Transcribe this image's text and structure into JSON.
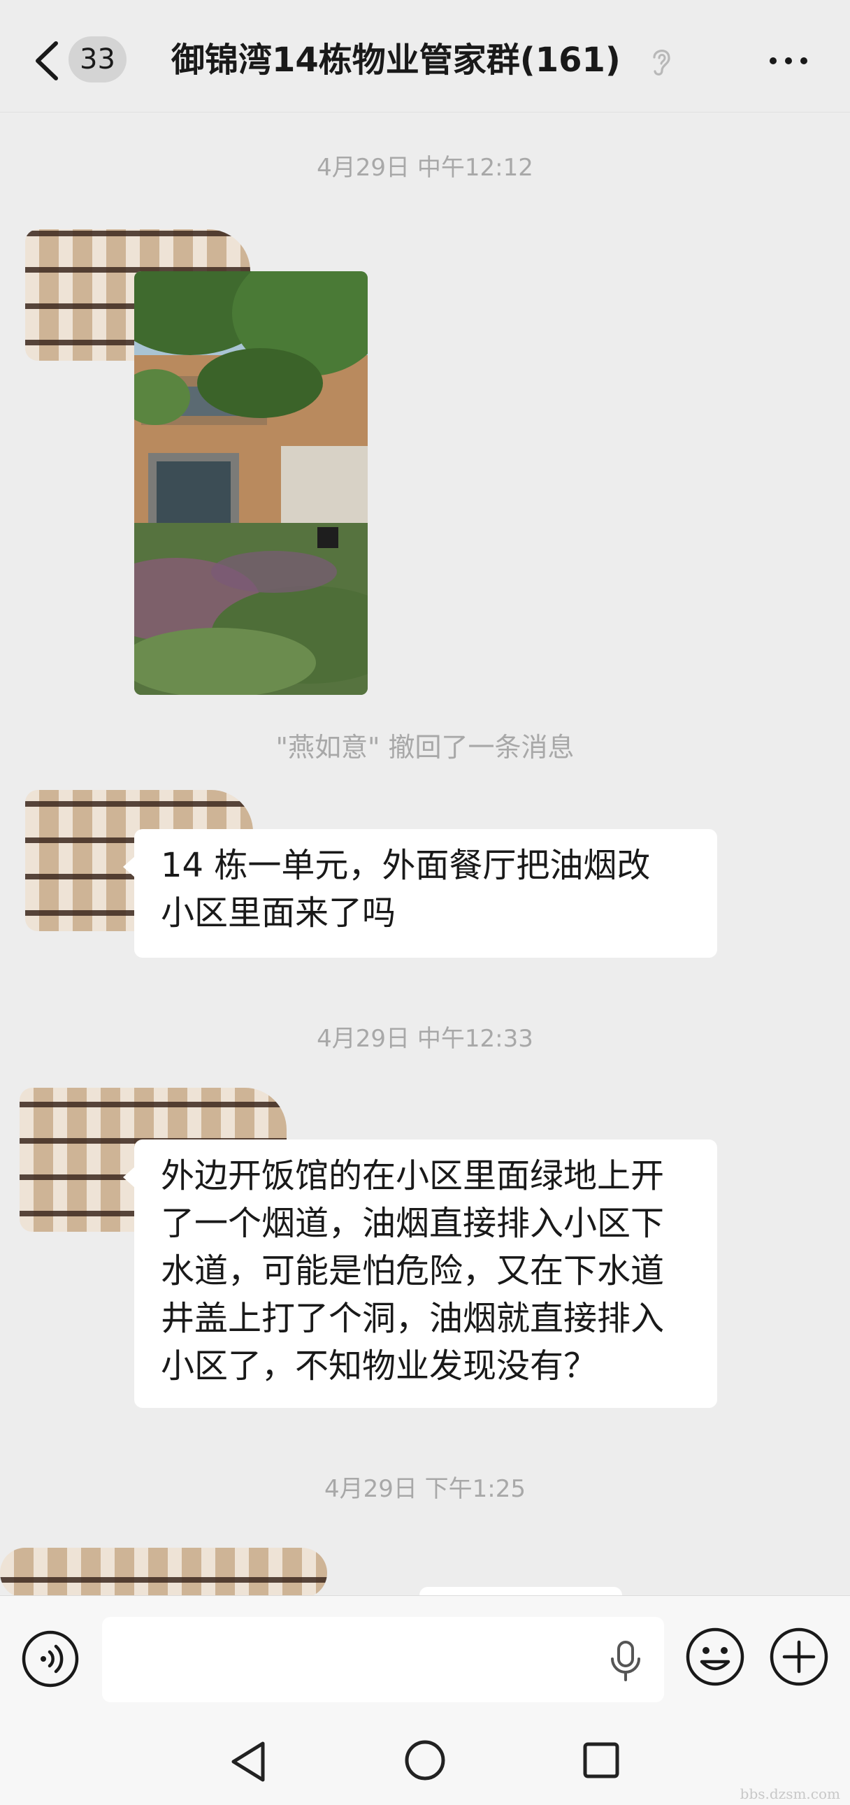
{
  "header": {
    "back_count": "33",
    "title": "御锦湾14栋物业管家群(161)"
  },
  "messages": [
    {
      "type": "timestamp",
      "text": "4月29日 中午12:12"
    },
    {
      "type": "image",
      "sender": "redacted"
    },
    {
      "type": "system",
      "text": "\"燕如意\" 撤回了一条消息"
    },
    {
      "type": "text",
      "sender": "redacted",
      "text": "14 栋一单元，外面餐厅把油烟改\n小区里面来了吗"
    },
    {
      "type": "timestamp",
      "text": "4月29日 中午12:33"
    },
    {
      "type": "text",
      "sender": "redacted",
      "text": "外边开饭馆的在小区里面绿地上开\n了一个烟道，油烟直接排入小区下\n水道，可能是怕危险，又在下水道\n井盖上打了个洞，油烟就直接排入\n小区了，不知物业发现没有？"
    },
    {
      "type": "timestamp",
      "text": "4月29日 下午1:25"
    }
  ],
  "input": {
    "value": "",
    "placeholder": ""
  },
  "icons": {
    "back": "chevron-left-icon",
    "mute": "ear-icon",
    "more": "more-icon",
    "voice": "voice-icon",
    "mic": "mic-icon",
    "emoji": "emoji-icon",
    "plus": "plus-icon",
    "nav_back": "triangle-back-icon",
    "nav_home": "circle-home-icon",
    "nav_recent": "square-recent-icon"
  },
  "colors": {
    "background": "#ededed",
    "bubble": "#ffffff",
    "timestamp": "#a8a8a8"
  },
  "watermark": "bbs.dzsm.com"
}
